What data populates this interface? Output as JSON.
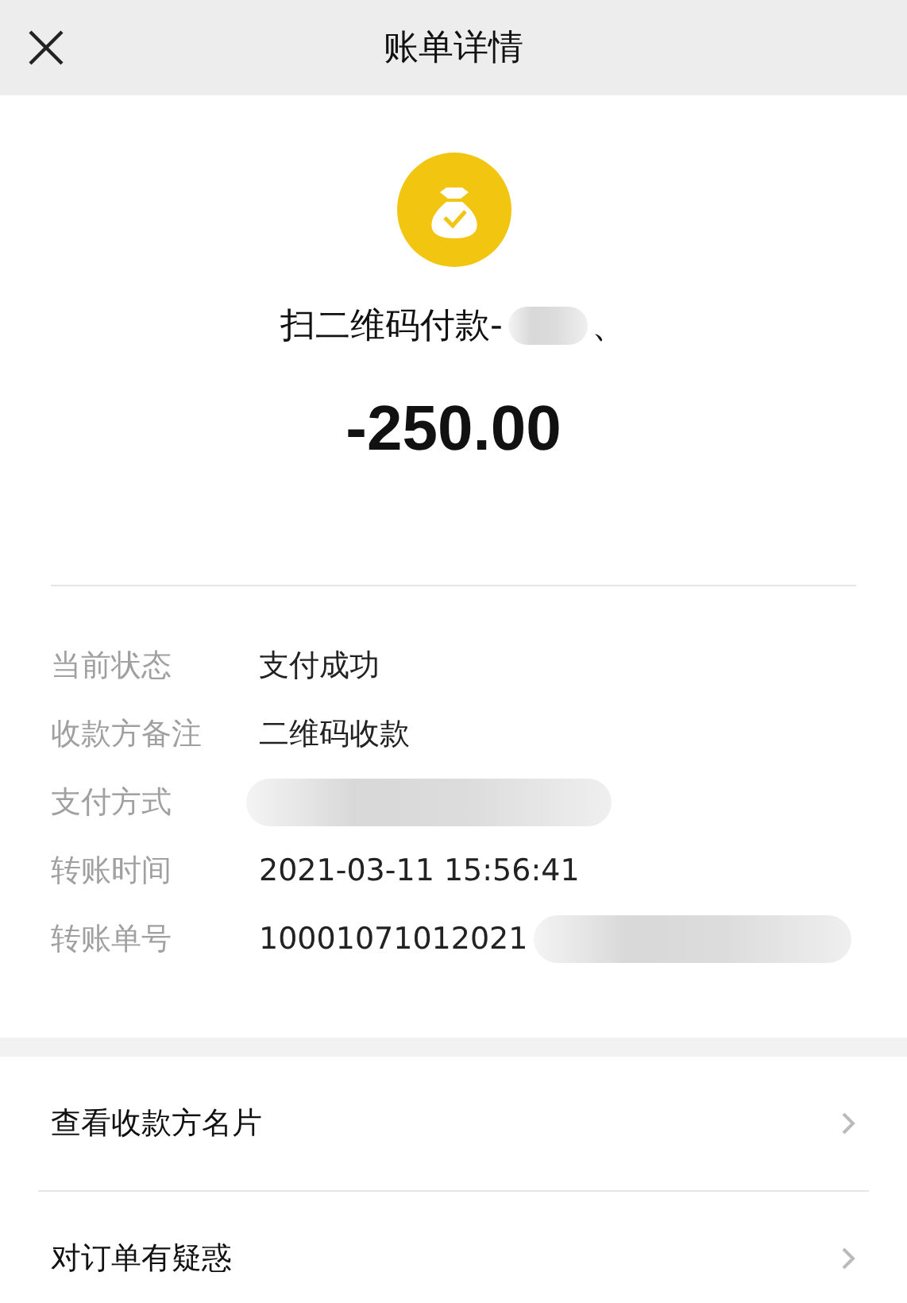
{
  "header": {
    "title": "账单详情"
  },
  "summary": {
    "title": "扫二维码付款-",
    "title_redacted": true,
    "title_after": "、",
    "amount": "-250.00"
  },
  "details": [
    {
      "label": "当前状态",
      "value": "支付成功",
      "redacted": false
    },
    {
      "label": "收款方备注",
      "value": "二维码收款",
      "redacted": false
    },
    {
      "label": "支付方式",
      "redacted": true
    },
    {
      "label": "转账时间",
      "value": "2021-03-11 15:56:41",
      "redacted": false
    },
    {
      "label": "转账单号",
      "value": "10001071012021",
      "redacted": true
    }
  ],
  "actions": [
    {
      "label": "查看收款方名片"
    },
    {
      "label": "对订单有疑惑"
    }
  ]
}
